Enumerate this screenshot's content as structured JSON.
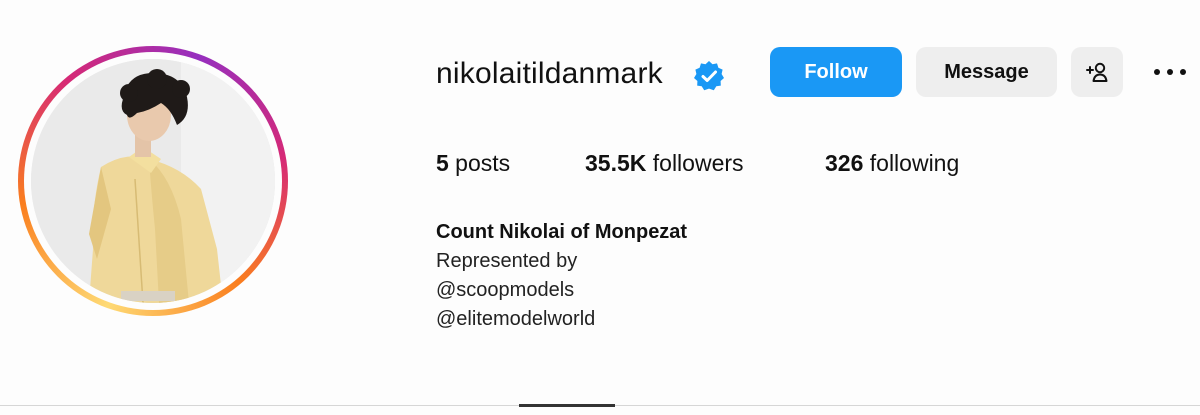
{
  "profile": {
    "username": "nikolaitildanmark",
    "verified_icon": "verified-badge-icon",
    "avatar_icon": "profile-photo",
    "accent": "#1a98f5"
  },
  "actions": {
    "follow_label": "Follow",
    "message_label": "Message",
    "add_user_icon": "add-user-icon",
    "more_icon": "more-options-icon"
  },
  "stats": {
    "posts_count": "5",
    "posts_label": " posts",
    "followers_count": "35.5K",
    "followers_label": " followers",
    "following_count": "326",
    "following_label": " following"
  },
  "bio": {
    "full_name": "Count Nikolai of Monpezat",
    "lines": [
      "Represented by",
      "@scoopmodels",
      "@elitemodelworld"
    ]
  }
}
